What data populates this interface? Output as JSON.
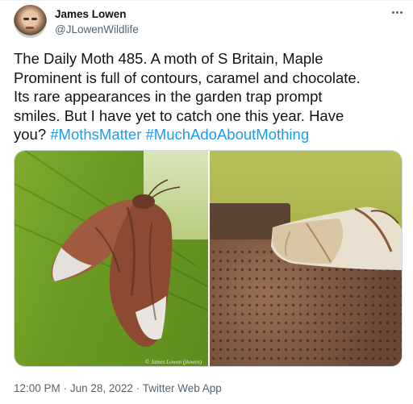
{
  "author": {
    "name": "James Lowen",
    "handle": "@JLowenWildlife"
  },
  "tweet": {
    "text_line_1": "The Daily Moth 485. A moth of S Britain, Maple",
    "text_line_2": "Prominent is full of contours, caramel and chocolate.",
    "text_line_3": "Its rare appearances in the garden trap prompt",
    "text_line_4": "smiles. But I have yet to catch one this year. Have",
    "text_line_5_prefix": "you?",
    "hashtag_1": "#MothsMatter",
    "hashtag_2": "#MuchAdoAboutMothing"
  },
  "media": {
    "watermark": "© James Lowen (jlowen)"
  },
  "meta": {
    "time": "12:00 PM",
    "separator": "·",
    "date": "Jun 28, 2022",
    "app": "Twitter Web App"
  },
  "icons": {
    "more": "more-dots-icon"
  },
  "colors": {
    "link": "#1d9bf0",
    "secondary_text": "#536471",
    "primary_text": "#0f1419"
  }
}
